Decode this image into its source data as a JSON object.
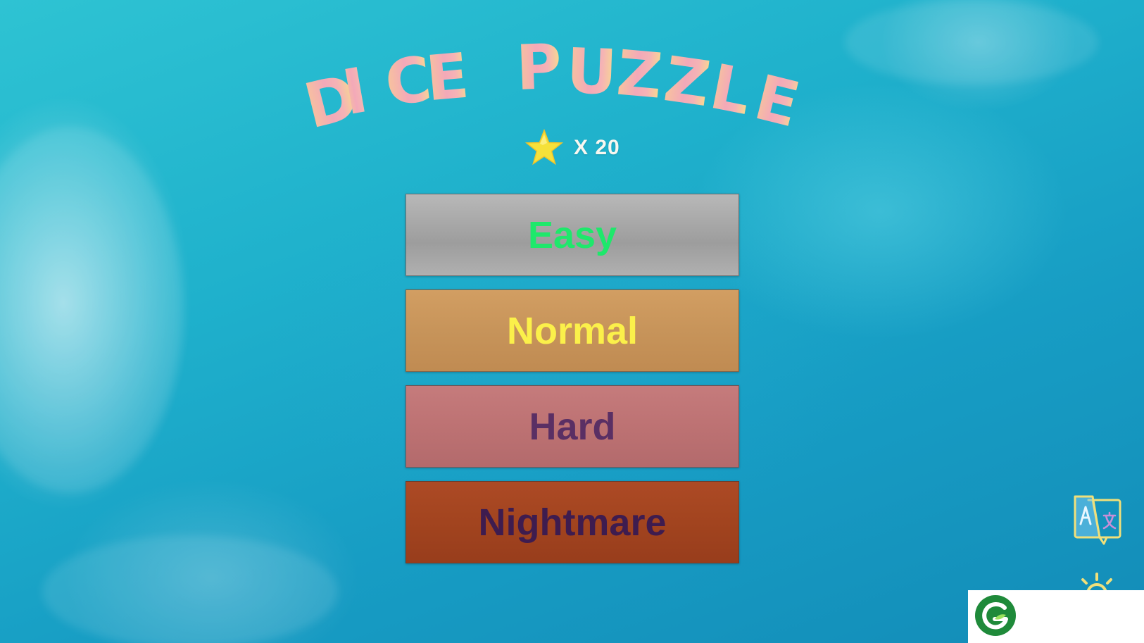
{
  "game": {
    "title": "DICE PUZZLE",
    "title_letters": [
      "D",
      "I",
      "C",
      "E",
      "P",
      "U",
      "Z",
      "Z",
      "L",
      "E"
    ]
  },
  "stars": {
    "count_label": "X 20",
    "icon": "star-icon",
    "color": "#f5e13a"
  },
  "levels": [
    {
      "label": "Easy",
      "text_color": "#1ee86b",
      "bg_color": "#a6a6a6"
    },
    {
      "label": "Normal",
      "text_color": "#fbf04a",
      "bg_color": "#c7945a"
    },
    {
      "label": "Hard",
      "text_color": "#5a2f64",
      "bg_color": "#bd7273"
    },
    {
      "label": "Nightmare",
      "text_color": "#3e1c4f",
      "bg_color": "#a2441f"
    }
  ],
  "side_controls": {
    "language_icon": "translate-icon",
    "settings_icon": "sun-gear-icon",
    "icon_color": "#f0e07a"
  },
  "ad": {
    "logo_icon": "g-leaf-logo",
    "logo_color": "#1f8a3a"
  }
}
